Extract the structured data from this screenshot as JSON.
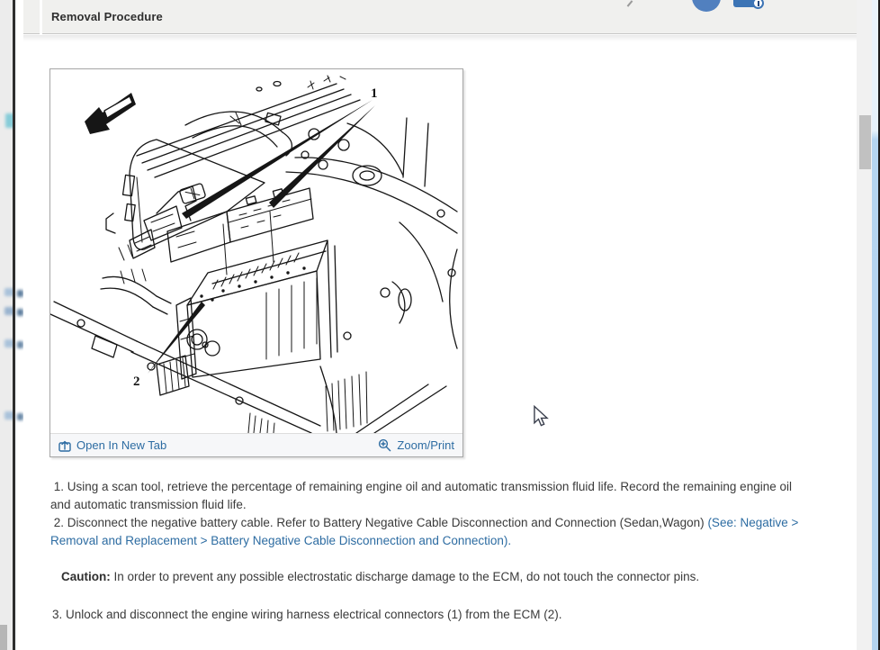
{
  "header": {
    "title": "Removal Procedure",
    "toolbar": {
      "profile_icon": "user-circle-icon",
      "print_icon": "printer-icon"
    }
  },
  "figure": {
    "open_in_new_tab_label": "Open In New Tab",
    "zoom_print_label": "Zoom/Print",
    "callout_1": "1",
    "callout_2": "2",
    "description": "Engine compartment line drawing showing harness connectors (1) and ECM (2)"
  },
  "steps": {
    "step1": " 1. Using a scan tool, retrieve the percentage of remaining engine oil and automatic transmission fluid life. Record the remaining engine oil\nand automatic transmission fluid life.",
    "step2_prefix": " 2. Disconnect the negative battery cable. Refer to Battery Negative Cable Disconnection and Connection (Sedan,Wagon) ",
    "step2_link": "(See: Negative >\nRemoval and Replacement > Battery Negative Cable Disconnection and Connection).",
    "step3": "3. Unlock and disconnect the engine wiring harness electrical connectors (1) from the ECM (2)."
  },
  "caution": {
    "label": "Caution:",
    "text": " In order to prevent any possible electrostatic discharge damage to the ECM, do not touch the connector pins."
  },
  "colors": {
    "link_blue": "#2d6ca2",
    "toolbar_gray": "#f0f0ee",
    "accent_blue_strip": "#7ea7d4",
    "scroll_thumb": "#c1c1c1"
  }
}
